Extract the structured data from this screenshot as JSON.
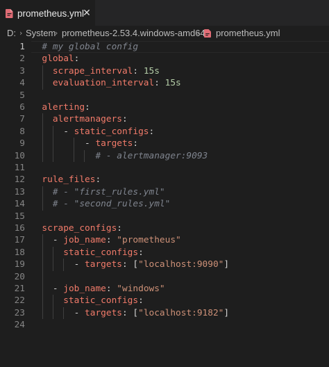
{
  "tab": {
    "title": "prometheus.yml",
    "close_glyph": "✕",
    "file_icon": "yaml-file-icon",
    "file_icon_color": "#e06c75"
  },
  "breadcrumb": {
    "items": [
      "D:",
      "System",
      "prometheus-2.53.4.windows-amd64",
      "prometheus.yml"
    ],
    "separator": "›"
  },
  "editor": {
    "active_line": 1,
    "colors": {
      "key": "#f27b6a",
      "number": "#b5cea8",
      "string": "#ce9178",
      "comment": "#7f848e",
      "text": "#d4d4d4",
      "background": "#1e1e1e"
    },
    "lines": [
      {
        "n": "1",
        "tokens": [
          [
            "c",
            "  # my global config"
          ]
        ]
      },
      {
        "n": "2",
        "tokens": [
          [
            "k",
            "  global"
          ],
          [
            "p",
            ":"
          ]
        ]
      },
      {
        "n": "3",
        "tokens": [
          [
            "k",
            "    scrape_interval"
          ],
          [
            "p",
            ": "
          ],
          [
            "n",
            "15s"
          ]
        ]
      },
      {
        "n": "4",
        "tokens": [
          [
            "k",
            "    evaluation_interval"
          ],
          [
            "p",
            ": "
          ],
          [
            "n",
            "15s"
          ]
        ]
      },
      {
        "n": "5",
        "tokens": []
      },
      {
        "n": "6",
        "tokens": [
          [
            "k",
            "  alerting"
          ],
          [
            "p",
            ":"
          ]
        ]
      },
      {
        "n": "7",
        "tokens": [
          [
            "k",
            "    alertmanagers"
          ],
          [
            "p",
            ":"
          ]
        ]
      },
      {
        "n": "8",
        "tokens": [
          [
            "p",
            "      - "
          ],
          [
            "k",
            "static_configs"
          ],
          [
            "p",
            ":"
          ]
        ]
      },
      {
        "n": "9",
        "tokens": [
          [
            "p",
            "          - "
          ],
          [
            "k",
            "targets"
          ],
          [
            "p",
            ":"
          ]
        ]
      },
      {
        "n": "10",
        "tokens": [
          [
            "c",
            "            # - alertmanager:9093"
          ]
        ]
      },
      {
        "n": "11",
        "tokens": []
      },
      {
        "n": "12",
        "tokens": [
          [
            "k",
            "  rule_files"
          ],
          [
            "p",
            ":"
          ]
        ]
      },
      {
        "n": "13",
        "tokens": [
          [
            "c",
            "    # - \"first_rules.yml\""
          ]
        ]
      },
      {
        "n": "14",
        "tokens": [
          [
            "c",
            "    # - \"second_rules.yml\""
          ]
        ]
      },
      {
        "n": "15",
        "tokens": []
      },
      {
        "n": "16",
        "tokens": [
          [
            "k",
            "  scrape_configs"
          ],
          [
            "p",
            ":"
          ]
        ]
      },
      {
        "n": "17",
        "tokens": [
          [
            "p",
            "    - "
          ],
          [
            "k",
            "job_name"
          ],
          [
            "p",
            ": "
          ],
          [
            "s",
            "\"prometheus\""
          ]
        ]
      },
      {
        "n": "18",
        "tokens": [
          [
            "k",
            "      static_configs"
          ],
          [
            "p",
            ":"
          ]
        ]
      },
      {
        "n": "19",
        "tokens": [
          [
            "p",
            "        - "
          ],
          [
            "k",
            "targets"
          ],
          [
            "p",
            ": ["
          ],
          [
            "s",
            "\"localhost:9090\""
          ],
          [
            "p",
            "]"
          ]
        ]
      },
      {
        "n": "20",
        "tokens": []
      },
      {
        "n": "21",
        "tokens": [
          [
            "p",
            "    - "
          ],
          [
            "k",
            "job_name"
          ],
          [
            "p",
            ": "
          ],
          [
            "s",
            "\"windows\""
          ]
        ]
      },
      {
        "n": "22",
        "tokens": [
          [
            "k",
            "      static_configs"
          ],
          [
            "p",
            ":"
          ]
        ]
      },
      {
        "n": "23",
        "tokens": [
          [
            "p",
            "        - "
          ],
          [
            "k",
            "targets"
          ],
          [
            "p",
            ": ["
          ],
          [
            "s",
            "\"localhost:9182\""
          ],
          [
            "p",
            "]"
          ]
        ]
      },
      {
        "n": "24",
        "tokens": []
      }
    ]
  }
}
